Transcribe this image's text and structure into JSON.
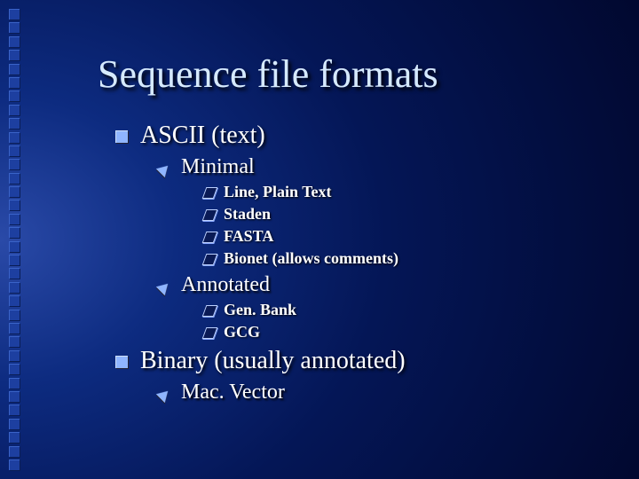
{
  "title": "Sequence file formats",
  "bullets": [
    {
      "label": "ASCII (text)",
      "children": [
        {
          "label": "Minimal",
          "children": [
            {
              "label": "Line, Plain Text"
            },
            {
              "label": "Staden"
            },
            {
              "label": "FASTA"
            },
            {
              "label": "Bionet (allows comments)"
            }
          ]
        },
        {
          "label": "Annotated",
          "children": [
            {
              "label": "Gen. Bank"
            },
            {
              "label": "GCG"
            }
          ]
        }
      ]
    },
    {
      "label": "Binary (usually annotated)",
      "children": [
        {
          "label": "Mac. Vector"
        }
      ]
    }
  ]
}
